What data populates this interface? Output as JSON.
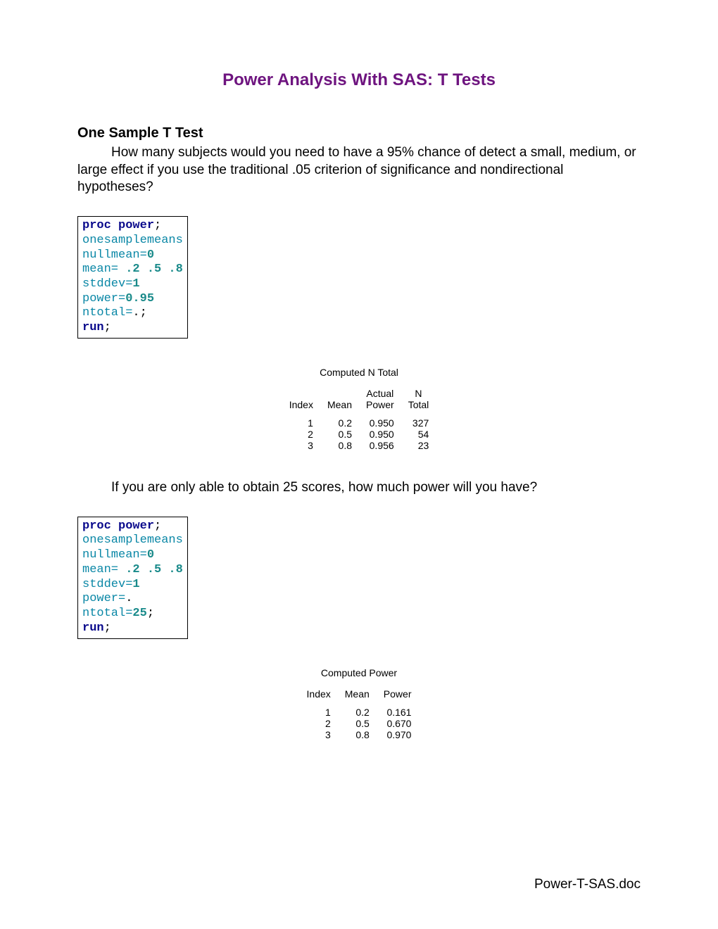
{
  "title": "Power Analysis With SAS:  T Tests",
  "section1": {
    "heading": "One Sample T Test",
    "paragraph": "How many subjects would you need to have a 95% chance of detect a small, medium, or large effect if you use the traditional .05 criterion of significance and nondirectional hypotheses?"
  },
  "code1": {
    "proc": "proc power",
    "l1": "onesamplemeans",
    "l2a": "nullmean=",
    "l2b": "0",
    "l3a": "mean= ",
    "l3b": ".2 .5 .8",
    "l4a": "stddev=",
    "l4b": "1",
    "l5a": "power=",
    "l5b": "0.95",
    "l6a": "ntotal=",
    "l6b": ".",
    "run": "run"
  },
  "output1": {
    "title": "Computed N Total",
    "headers": {
      "c1": "Index",
      "c2": "Mean",
      "c3a": "Actual",
      "c3b": "Power",
      "c4a": "N",
      "c4b": "Total"
    },
    "rows": [
      {
        "index": "1",
        "mean": "0.2",
        "power": "0.950",
        "ntotal": "327"
      },
      {
        "index": "2",
        "mean": "0.5",
        "power": "0.950",
        "ntotal": "54"
      },
      {
        "index": "3",
        "mean": "0.8",
        "power": "0.956",
        "ntotal": "23"
      }
    ]
  },
  "paragraph2": "If you are only able to obtain 25 scores, how much power will you have?",
  "code2": {
    "proc": "proc power",
    "l1": "onesamplemeans",
    "l2a": "nullmean=",
    "l2b": "0",
    "l3a": "mean= ",
    "l3b": ".2 .5 .8",
    "l4a": "stddev=",
    "l4b": "1",
    "l5a": "power=",
    "l5b": ".",
    "l6a": "ntotal=",
    "l6b": "25",
    "run": "run"
  },
  "output2": {
    "title": "Computed Power",
    "headers": {
      "c1": "Index",
      "c2": "Mean",
      "c3": "Power"
    },
    "rows": [
      {
        "index": "1",
        "mean": "0.2",
        "power": "0.161"
      },
      {
        "index": "2",
        "mean": "0.5",
        "power": "0.670"
      },
      {
        "index": "3",
        "mean": "0.8",
        "power": "0.970"
      }
    ]
  },
  "footer": "Power-T-SAS.doc"
}
